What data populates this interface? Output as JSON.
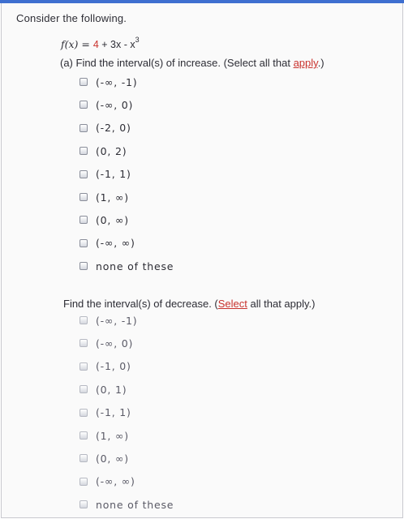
{
  "prompt": "Consider the following.",
  "function": {
    "name": "f(x) = ",
    "constant": "4",
    "middle": " + 3x - x",
    "exponent": "3"
  },
  "part_a": {
    "before_link": "(a) Find the interval(s) of increase. (Select all that ",
    "link": "apply",
    "after_link": ".)",
    "options": [
      "(-∞, -1)",
      "(-∞, 0)",
      "(-2, 0)",
      "(0, 2)",
      "(-1, 1)",
      "(1, ∞)",
      "(0, ∞)",
      "(-∞, ∞)",
      "none of these"
    ]
  },
  "part_b": {
    "before_link": "Find the interval(s) of decrease. (",
    "link": "Select",
    "after_link": " all that apply.)",
    "options": [
      "(-∞, -1)",
      "(-∞, 0)",
      "(-1, 0)",
      "(0, 1)",
      "(-1, 1)",
      "(1, ∞)",
      "(0, ∞)",
      "(-∞, ∞)",
      "none of these"
    ]
  }
}
